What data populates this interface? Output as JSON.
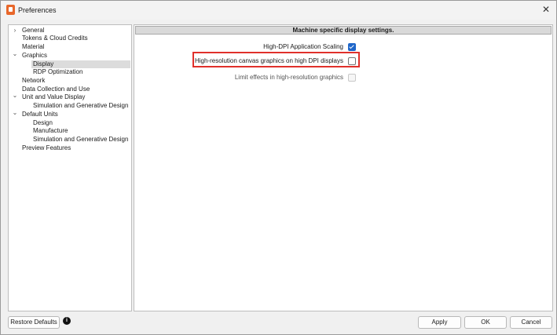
{
  "window": {
    "title": "Preferences",
    "app_icon": "fusion-app-icon",
    "close_glyph": "✕"
  },
  "tree": {
    "items": [
      {
        "label": "General",
        "chevron": "›"
      },
      {
        "label": "Tokens & Cloud Credits",
        "chevron": ""
      },
      {
        "label": "Material",
        "chevron": ""
      },
      {
        "label": "Graphics",
        "chevron": "⌄"
      },
      {
        "label": "Display",
        "chevron": "",
        "selected": true
      },
      {
        "label": "RDP Optimization",
        "chevron": ""
      },
      {
        "label": "Network",
        "chevron": ""
      },
      {
        "label": "Data Collection and Use",
        "chevron": ""
      },
      {
        "label": "Unit and Value Display",
        "chevron": "⌄"
      },
      {
        "label": "Simulation and Generative Design",
        "chevron": ""
      },
      {
        "label": "Default Units",
        "chevron": "⌄"
      },
      {
        "label": "Design",
        "chevron": ""
      },
      {
        "label": "Manufacture",
        "chevron": ""
      },
      {
        "label": "Simulation and Generative Design",
        "chevron": ""
      },
      {
        "label": "Preview Features",
        "chevron": ""
      }
    ]
  },
  "panel": {
    "header": "Machine specific display settings.",
    "options": [
      {
        "label": "High-DPI Application Scaling",
        "checked": true,
        "disabled": false
      },
      {
        "label": "High-resolution canvas graphics on high DPI displays",
        "checked": false,
        "disabled": false,
        "highlighted": true
      },
      {
        "label": "Limit effects in high-resolution graphics",
        "checked": false,
        "disabled": true
      }
    ]
  },
  "footer": {
    "restore_label": "Restore Defaults",
    "info_glyph": "i",
    "apply_label": "Apply",
    "ok_label": "OK",
    "cancel_label": "Cancel"
  },
  "colors": {
    "highlight": "#e0302b",
    "checkbox_checked": "#1e66c9",
    "app_icon": "#e8672a"
  }
}
